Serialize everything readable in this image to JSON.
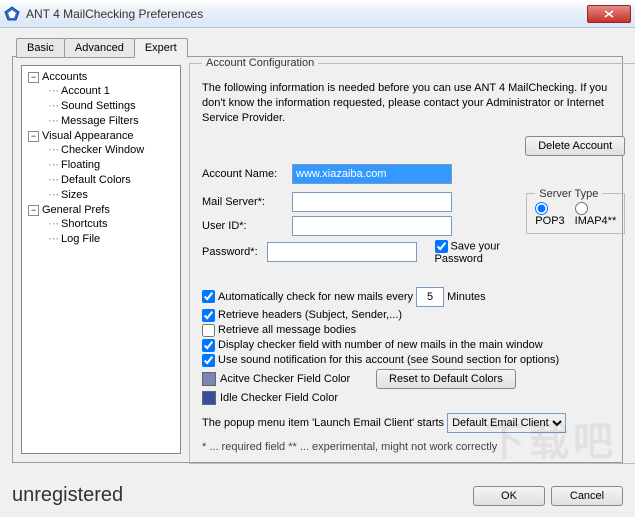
{
  "window": {
    "title": "ANT 4 MailChecking Preferences"
  },
  "tabs": {
    "basic": "Basic",
    "advanced": "Advanced",
    "expert": "Expert"
  },
  "tree": {
    "accounts": "Accounts",
    "account1": "Account 1",
    "sound": "Sound Settings",
    "filters": "Message Filters",
    "visual": "Visual Appearance",
    "checker": "Checker Window",
    "floating": "Floating",
    "colors": "Default Colors",
    "sizes": "Sizes",
    "general": "General Prefs",
    "shortcuts": "Shortcuts",
    "logfile": "Log File"
  },
  "config": {
    "legend": "Account Configuration",
    "intro": "The following information is needed before you can use ANT 4 MailChecking. If you don't know the information requested, please contact your Administrator or Internet Service Provider.",
    "delete": "Delete Account",
    "account_name_label": "Account Name:",
    "account_name_value": "www.xiazaiba.com",
    "mail_server_label": "Mail Server*:",
    "user_id_label": "User ID*:",
    "password_label": "Password*:",
    "save_password": "Save your Password",
    "server_type_legend": "Server Type",
    "pop3": "POP3",
    "imap4": "IMAP4**",
    "auto_check": "Automatically check for new mails every",
    "minutes_value": "5",
    "minutes_label": "Minutes",
    "retrieve_headers": "Retrieve headers (Subject, Sender,...)",
    "retrieve_bodies": "Retrieve all message bodies",
    "display_checker": "Display checker field with number of new mails in the main window",
    "use_sound": "Use sound notification for this account (see Sound section for options)",
    "active_color": "Acitve Checker Field Color",
    "idle_color": "Idle Checker Field Color",
    "reset_colors": "Reset to Default Colors",
    "popup_text": "The popup menu item 'Launch Email Client' starts",
    "popup_value": "Default Email Client",
    "footnote": "* ... required field      ** ... experimental, might not work correctly"
  },
  "footer": {
    "unregistered": "unregistered",
    "ok": "OK",
    "cancel": "Cancel"
  },
  "watermark": "下载吧"
}
